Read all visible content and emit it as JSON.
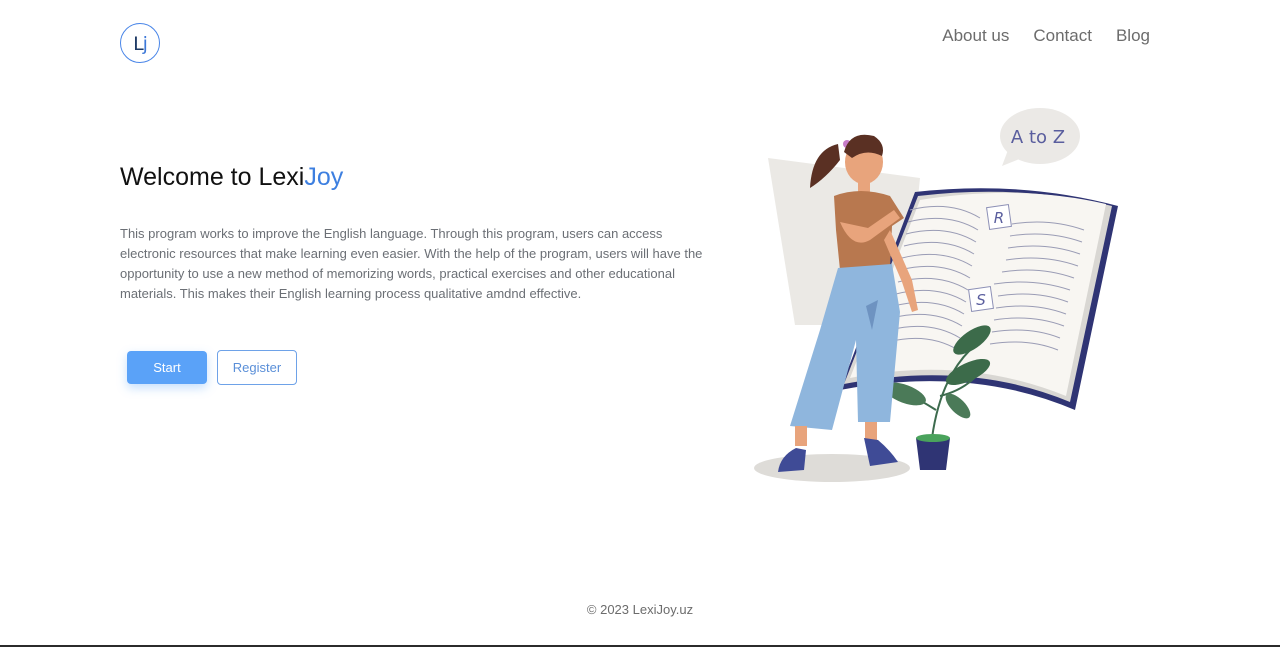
{
  "header": {
    "logo_text": "Lj",
    "nav": [
      {
        "label": "About us"
      },
      {
        "label": "Contact"
      },
      {
        "label": "Blog"
      }
    ]
  },
  "hero": {
    "title_prefix": "Welcome to Lexi",
    "title_accent": "Joy",
    "description": "This program works to improve the English language. Through this program, users can access electronic resources that make learning even easier. With the help of the program, users will have the opportunity to use a new method of memorizing words, practical exercises and other educational materials. This makes their English learning process qualitative amdnd effective.",
    "start_label": "Start",
    "register_label": "Register"
  },
  "illustration": {
    "speech_bubble_text": "A to Z",
    "book_letters": [
      "R",
      "S"
    ]
  },
  "footer": {
    "copyright": "© 2023 LexiJoy.uz"
  },
  "colors": {
    "accent": "#3d7fe0",
    "primary_button": "#5aa2f8",
    "book_spine": "#2f3474"
  }
}
